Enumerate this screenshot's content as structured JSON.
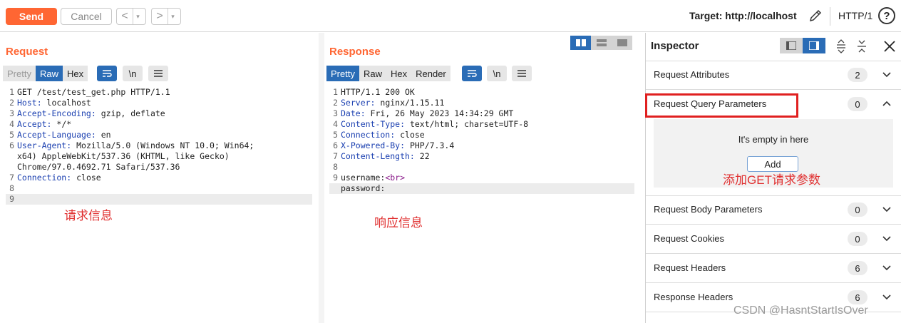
{
  "toolbar": {
    "send_label": "Send",
    "cancel_label": "Cancel",
    "back_arrow": "<",
    "forward_arrow": ">",
    "dropdown_arrow": "▾",
    "target_text": "Target: http://localhost",
    "http_version": "HTTP/1",
    "help_label": "?",
    "edit_icon": "pencil-icon"
  },
  "request": {
    "title": "Request",
    "tabs": [
      {
        "label": "Pretty"
      },
      {
        "label": "Raw"
      },
      {
        "label": "Hex"
      }
    ],
    "active_tab": "Raw",
    "tools": {
      "wrap_icon": "wrap-icon",
      "newline_label": "\\n",
      "menu_icon": "menu-icon"
    },
    "lines": [
      {
        "n": "1",
        "key": "",
        "text": "GET /test/test_get.php HTTP/1.1"
      },
      {
        "n": "2",
        "key": "Host:",
        "text": " localhost"
      },
      {
        "n": "3",
        "key": "Accept-Encoding:",
        "text": " gzip, deflate"
      },
      {
        "n": "4",
        "key": "Accept:",
        "text": " */*"
      },
      {
        "n": "5",
        "key": "Accept-Language:",
        "text": " en"
      },
      {
        "n": "6",
        "key": "User-Agent:",
        "text": " Mozilla/5.0 (Windows NT 10.0; Win64;"
      },
      {
        "n": "",
        "key": "",
        "text": "x64) AppleWebKit/537.36 (KHTML, like Gecko)"
      },
      {
        "n": "",
        "key": "",
        "text": "Chrome/97.0.4692.71 Safari/537.36"
      },
      {
        "n": "7",
        "key": "Connection:",
        "text": " close"
      },
      {
        "n": "8",
        "key": "",
        "text": ""
      },
      {
        "n": "9",
        "key": "",
        "text": ""
      }
    ],
    "annotation": "请求信息"
  },
  "response": {
    "title": "Response",
    "tabs": [
      {
        "label": "Pretty"
      },
      {
        "label": "Raw"
      },
      {
        "label": "Hex"
      },
      {
        "label": "Render"
      }
    ],
    "active_tab": "Pretty",
    "tools": {
      "wrap_icon": "wrap-icon",
      "newline_label": "\\n",
      "menu_icon": "menu-icon"
    },
    "lines": [
      {
        "n": "1",
        "key": "",
        "text": "HTTP/1.1 200 OK"
      },
      {
        "n": "2",
        "key": "Server:",
        "text": " nginx/1.15.11"
      },
      {
        "n": "3",
        "key": "Date:",
        "text": " Fri, 26 May 2023 14:34:29 GMT"
      },
      {
        "n": "4",
        "key": "Content-Type:",
        "text": " text/html; charset=UTF-8"
      },
      {
        "n": "5",
        "key": "Connection:",
        "text": " close"
      },
      {
        "n": "6",
        "key": "X-Powered-By:",
        "text": " PHP/7.3.4"
      },
      {
        "n": "7",
        "key": "Content-Length:",
        "text": " 22"
      },
      {
        "n": "8",
        "key": "",
        "text": ""
      },
      {
        "n": "9",
        "key": "",
        "text": "username:",
        "tag": "<br>"
      },
      {
        "n": "",
        "key": "",
        "text": "password:"
      }
    ],
    "annotation": "响应信息"
  },
  "inspector": {
    "title": "Inspector",
    "rows": [
      {
        "label": "Request Attributes",
        "count": "2",
        "expanded": false
      },
      {
        "label": "Request Query Parameters",
        "count": "0",
        "expanded": true
      },
      {
        "label": "Request Body Parameters",
        "count": "0",
        "expanded": false
      },
      {
        "label": "Request Cookies",
        "count": "0",
        "expanded": false
      },
      {
        "label": "Request Headers",
        "count": "6",
        "expanded": false
      },
      {
        "label": "Response Headers",
        "count": "6",
        "expanded": false
      }
    ],
    "empty_text": "It's empty in here",
    "add_label": "Add",
    "annotation": "添加GET请求参数"
  },
  "watermark": "CSDN @HasntStartIsOver",
  "colors": {
    "accent": "#ff6633",
    "tab_active": "#2a6cb6",
    "annotation": "#e02020",
    "header_key": "#1a3fb0",
    "tag": "#8a1a8a"
  }
}
